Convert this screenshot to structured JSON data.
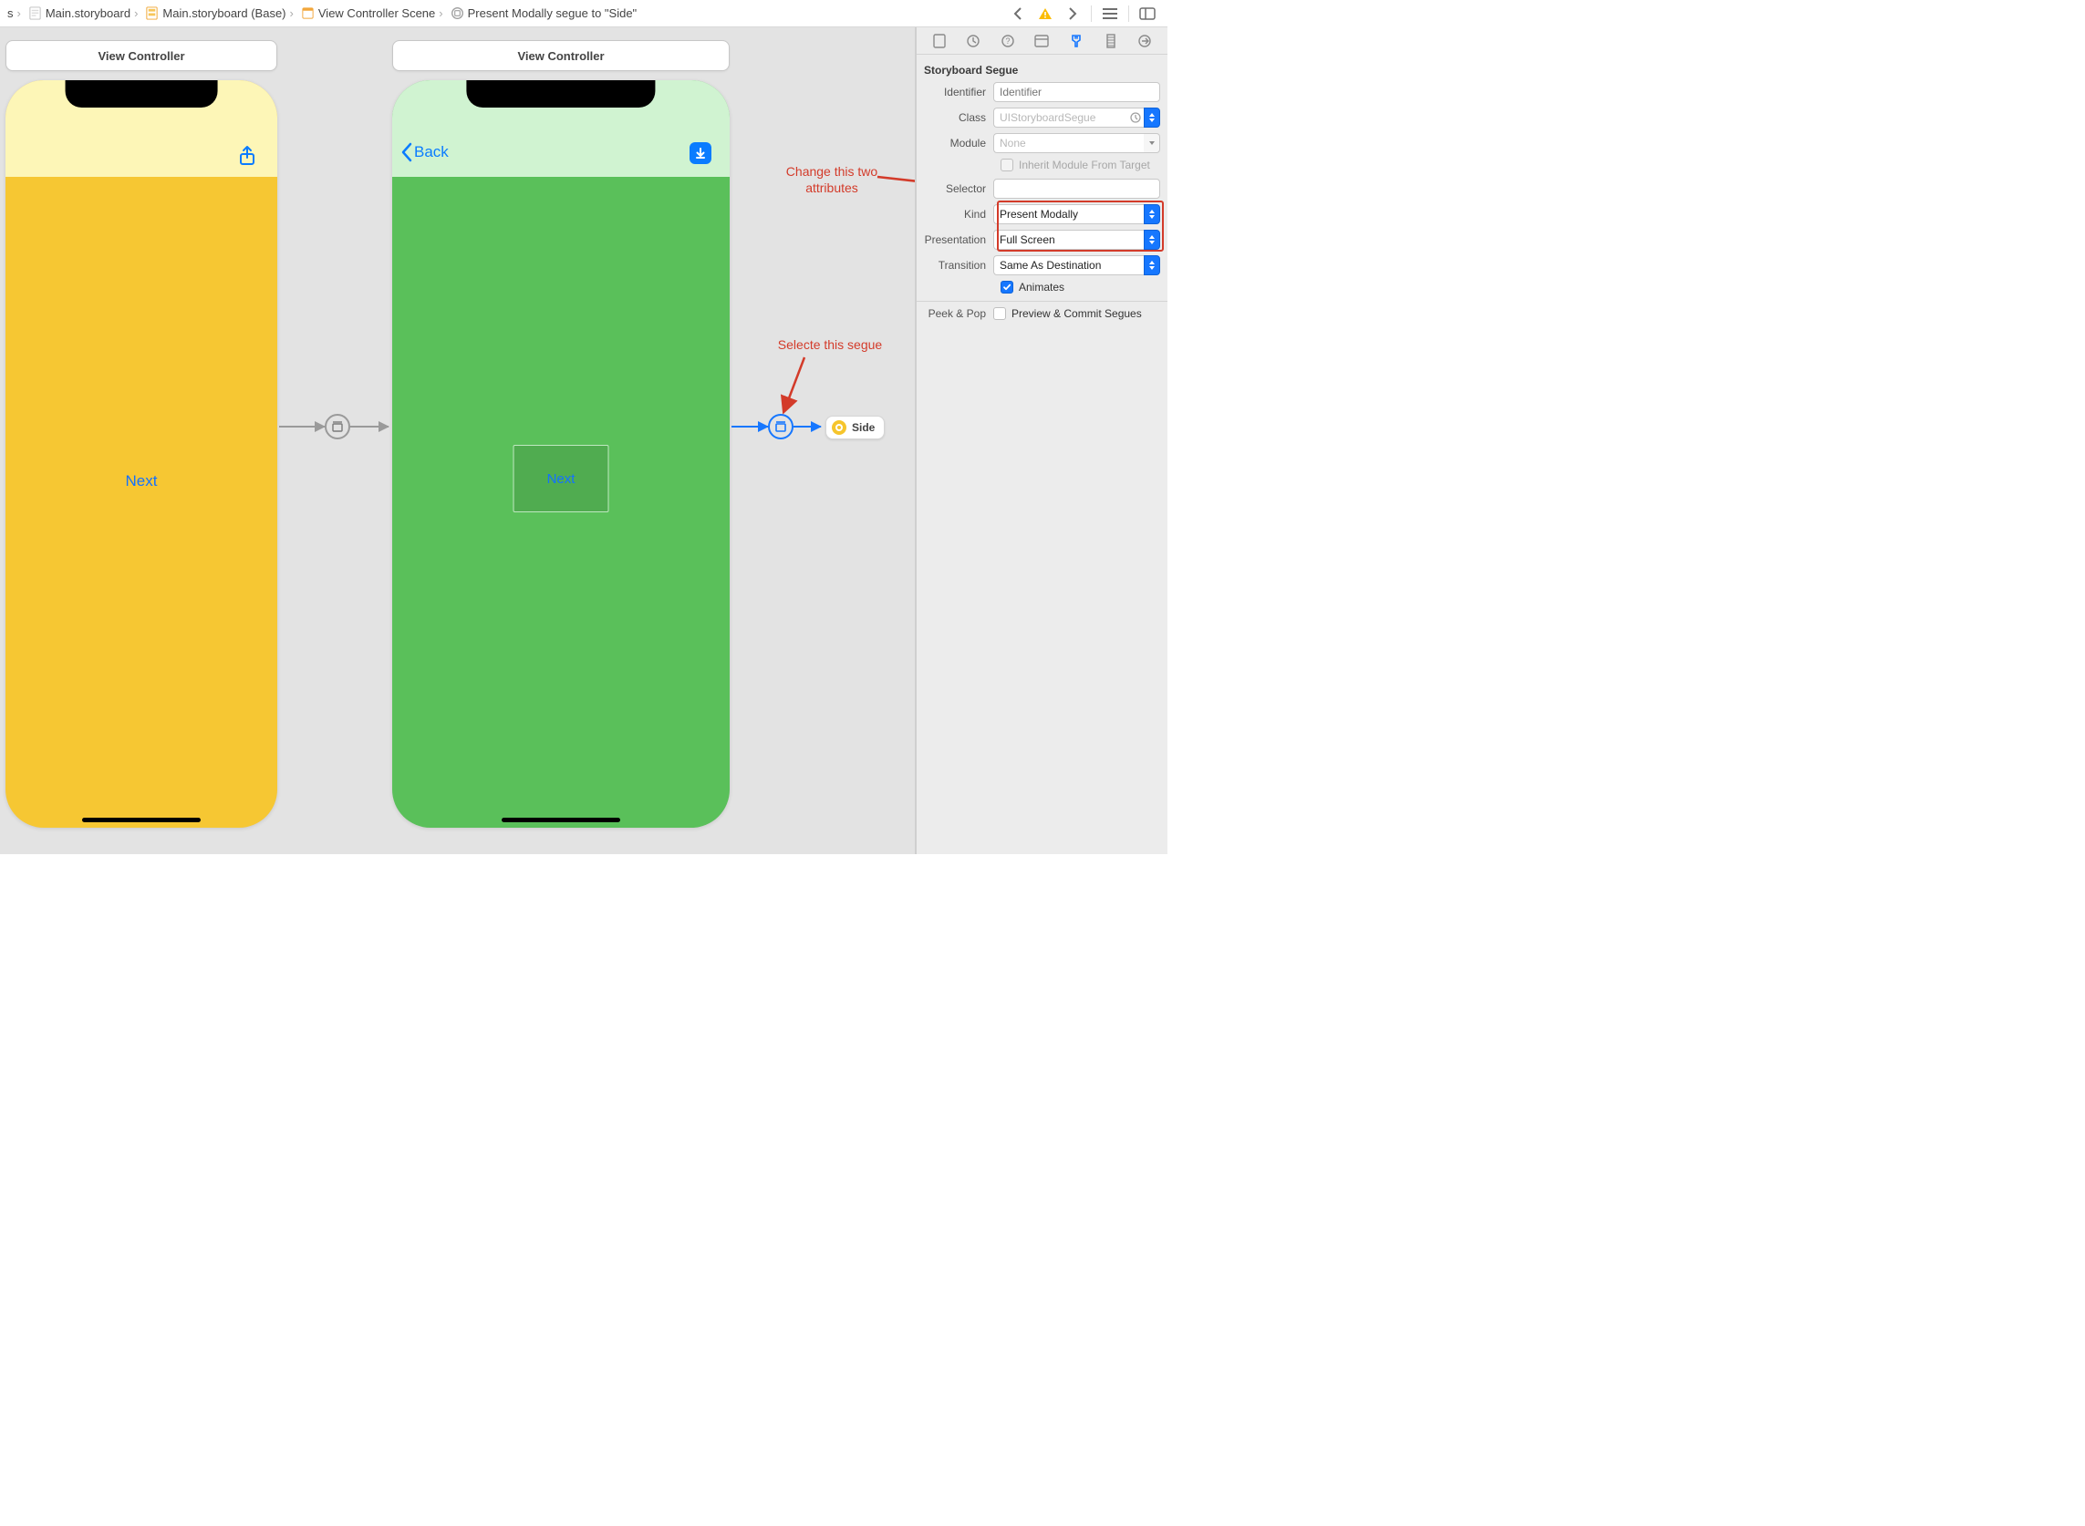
{
  "breadcrumbs": {
    "item0_suffix": "s",
    "item1": "Main.storyboard",
    "item2": "Main.storyboard (Base)",
    "item3": "View Controller Scene",
    "item4": "Present Modally segue to \"Side\""
  },
  "canvas": {
    "scene1_title": "View Controller",
    "scene2_title": "View Controller",
    "phone1_next": "Next",
    "phone2_back": "Back",
    "phone2_container": "Next",
    "side_chip": "Side"
  },
  "annotations": {
    "top": "Change this two\nattributes",
    "bottom": "Selecte this segue"
  },
  "inspector": {
    "header": "Storyboard Segue",
    "identifier_label": "Identifier",
    "identifier_placeholder": "Identifier",
    "class_label": "Class",
    "class_value": "UIStoryboardSegue",
    "module_label": "Module",
    "module_value": "None",
    "inherit_label": "Inherit Module From Target",
    "selector_label": "Selector",
    "selector_value": "",
    "kind_label": "Kind",
    "kind_value": "Present Modally",
    "presentation_label": "Presentation",
    "presentation_value": "Full Screen",
    "transition_label": "Transition",
    "transition_value": "Same As Destination",
    "animates_label": "Animates",
    "peek_label": "Peek & Pop",
    "peek_option": "Preview & Commit Segues"
  }
}
